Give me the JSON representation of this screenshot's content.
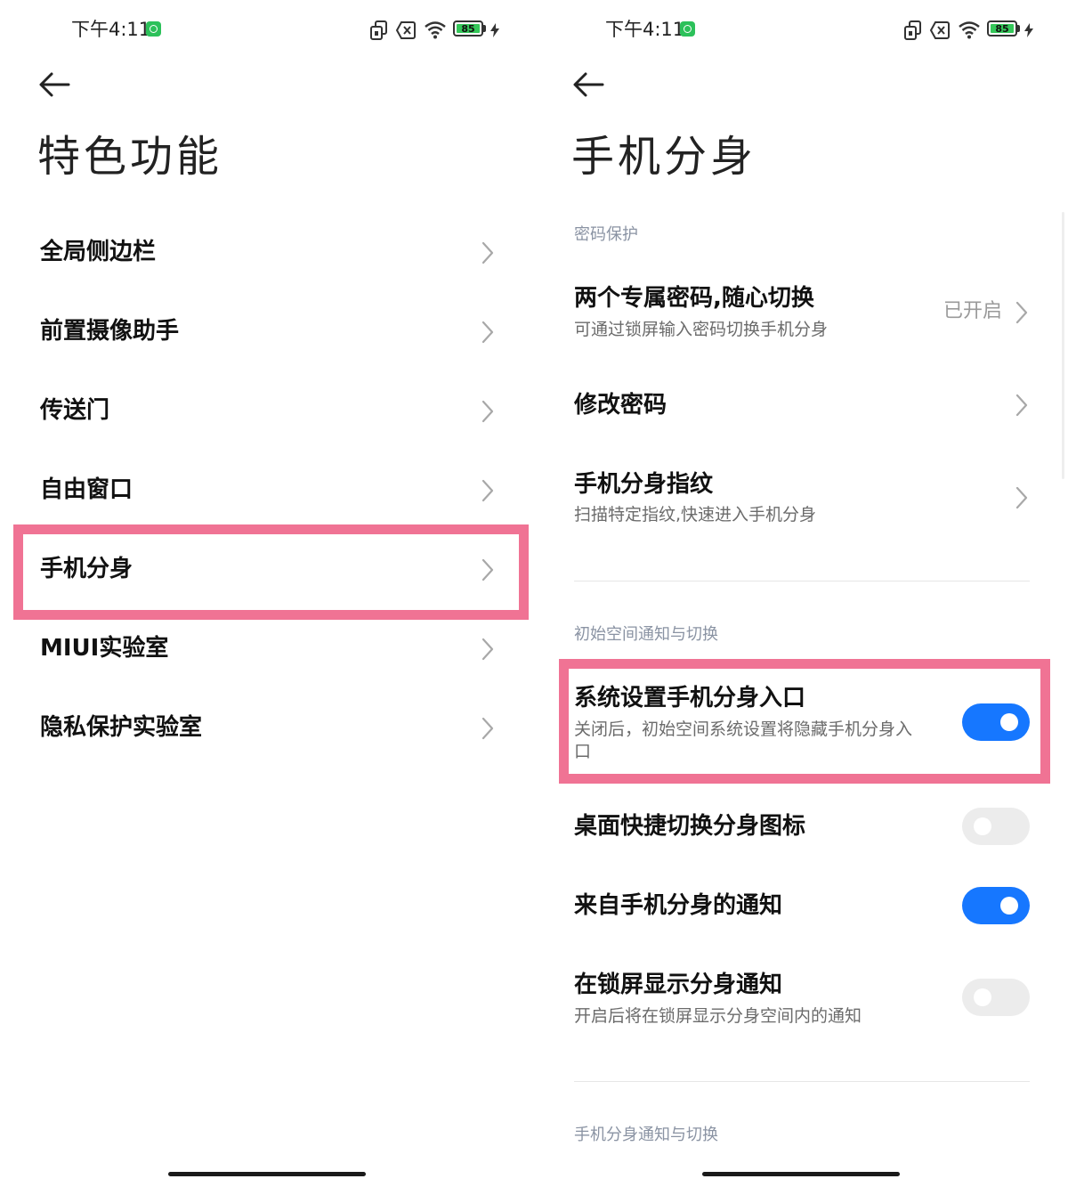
{
  "status_bar": {
    "time": "下午4:11",
    "battery": "85",
    "icons": [
      "app-notification-icon",
      "nfc-icon",
      "sim-x-icon",
      "wifi-icon",
      "battery-icon",
      "charging-icon"
    ]
  },
  "left_screen": {
    "title": "特色功能",
    "menu_items": [
      {
        "label": "全局侧边栏"
      },
      {
        "label": "前置摄像助手"
      },
      {
        "label": "传送门"
      },
      {
        "label": "自由窗口"
      },
      {
        "label": "手机分身",
        "highlighted": true
      },
      {
        "label": "MIUI实验室"
      },
      {
        "label": "隐私保护实验室"
      }
    ]
  },
  "right_screen": {
    "title": "手机分身",
    "sections": [
      {
        "header": "密码保护",
        "items": [
          {
            "title": "两个专属密码,随心切换",
            "subtitle": "可通过锁屏输入密码切换手机分身",
            "value": "已开启"
          },
          {
            "title": "修改密码"
          },
          {
            "title": "手机分身指纹",
            "subtitle": "扫描特定指纹,快速进入手机分身"
          }
        ]
      },
      {
        "header": "初始空间通知与切换",
        "items": [
          {
            "title": "系统设置手机分身入口",
            "subtitle_line1": "关闭后，初始空间系统设置将隐藏手机分身入",
            "subtitle_line2": "口",
            "toggle": true,
            "highlighted": true
          },
          {
            "title": "桌面快捷切换分身图标",
            "toggle": false
          },
          {
            "title": "来自手机分身的通知",
            "toggle": true
          },
          {
            "title": "在锁屏显示分身通知",
            "subtitle": "开启后将在锁屏显示分身空间内的通知",
            "toggle": false
          }
        ]
      },
      {
        "header": "手机分身通知与切换"
      }
    ]
  },
  "colors": {
    "highlight_border": "#f07394",
    "toggle_on": "#1677ff",
    "toggle_off": "#ececec",
    "section_header": "#8a93a3"
  }
}
